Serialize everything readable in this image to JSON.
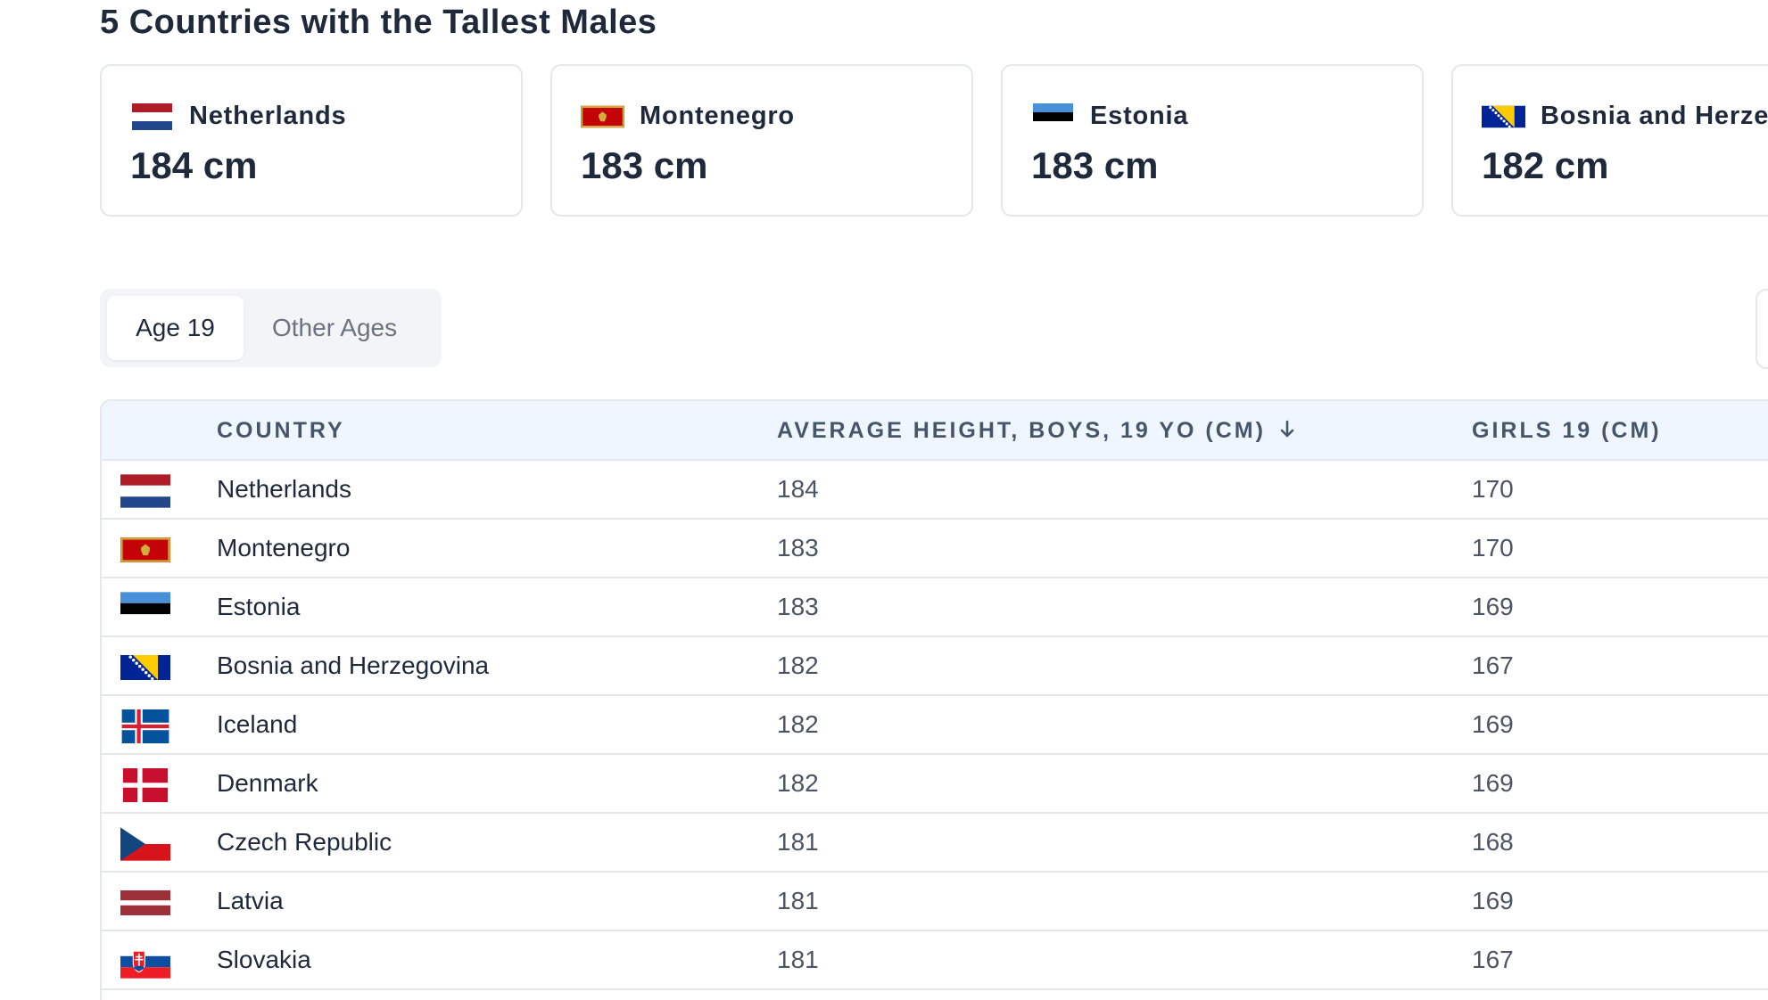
{
  "page": {
    "title": "5 Countries with the Tallest Males"
  },
  "cards": [
    {
      "country": "Netherlands",
      "value": "184 cm",
      "flag": "netherlands-flag-icon"
    },
    {
      "country": "Montenegro",
      "value": "183 cm",
      "flag": "montenegro-flag-icon"
    },
    {
      "country": "Estonia",
      "value": "183 cm",
      "flag": "estonia-flag-icon"
    },
    {
      "country": "Bosnia and Herzegovina",
      "value": "182 cm",
      "flag": "bosnia-flag-icon"
    }
  ],
  "tabs": [
    {
      "label": "Age 19",
      "active": true
    },
    {
      "label": "Other Ages",
      "active": false
    }
  ],
  "table": {
    "columns": {
      "country": "COUNTRY",
      "boys": "AVERAGE HEIGHT, BOYS, 19 YO (CM)",
      "girls": "GIRLS 19 (CM)"
    },
    "sort_icon": "arrow-down-icon",
    "rows": [
      {
        "country": "Netherlands",
        "boys": "184",
        "girls": "170",
        "flag": "netherlands-flag-icon"
      },
      {
        "country": "Montenegro",
        "boys": "183",
        "girls": "170",
        "flag": "montenegro-flag-icon"
      },
      {
        "country": "Estonia",
        "boys": "183",
        "girls": "169",
        "flag": "estonia-flag-icon"
      },
      {
        "country": "Bosnia and Herzegovina",
        "boys": "182",
        "girls": "167",
        "flag": "bosnia-flag-icon"
      },
      {
        "country": "Iceland",
        "boys": "182",
        "girls": "169",
        "flag": "iceland-flag-icon"
      },
      {
        "country": "Denmark",
        "boys": "182",
        "girls": "169",
        "flag": "denmark-flag-icon"
      },
      {
        "country": "Czech Republic",
        "boys": "181",
        "girls": "168",
        "flag": "czech-flag-icon"
      },
      {
        "country": "Latvia",
        "boys": "181",
        "girls": "169",
        "flag": "latvia-flag-icon"
      },
      {
        "country": "Slovakia",
        "boys": "181",
        "girls": "167",
        "flag": "slovakia-flag-icon"
      }
    ]
  },
  "colors": {
    "header_bg": "#eff6ff",
    "border": "#e5e7eb",
    "text_dark": "#1e293b",
    "text_muted": "#4b5563"
  }
}
